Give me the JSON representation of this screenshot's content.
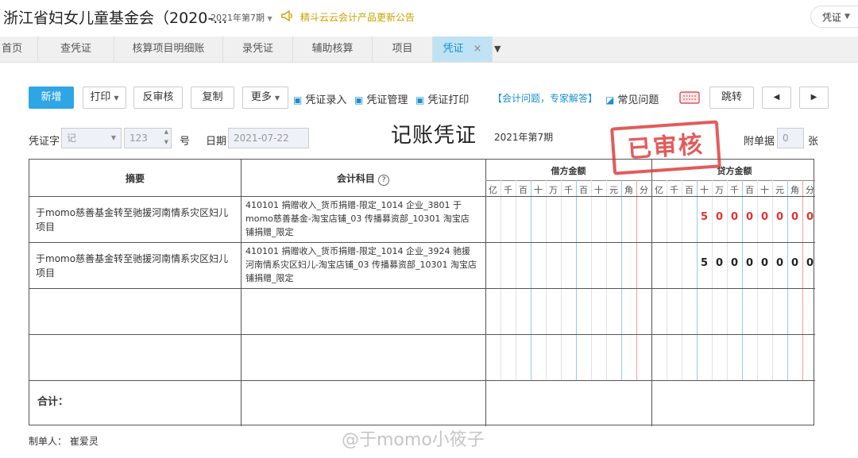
{
  "header": {
    "org_title": "浙江省妇女儿童基金会（2020-...",
    "period_selector": "2021年第7期",
    "notice": "精斗云云会计产品更新公告",
    "voucher_menu": "凭证"
  },
  "tabs": [
    {
      "label": "首页"
    },
    {
      "label": "查凭证"
    },
    {
      "label": "核算项目明细账"
    },
    {
      "label": "录凭证"
    },
    {
      "label": "辅助核算"
    },
    {
      "label": "项目"
    },
    {
      "label": "凭证",
      "active": true
    }
  ],
  "toolbar": {
    "add": "新增",
    "print": "打印",
    "unaudit": "反审核",
    "copy": "复制",
    "more": "更多",
    "entry_link": "凭证录入",
    "manage_link": "凭证管理",
    "print_link": "凭证打印",
    "help_link": "【会计问题，专家解答】",
    "faq_link": "常见问题",
    "jump": "跳转"
  },
  "voucher_header": {
    "word_label": "凭证字",
    "word_value": "记",
    "number_value": "123",
    "number_unit": "号",
    "date_label": "日期",
    "date_value": "2021-07-22",
    "title": "记账凭证",
    "period": "2021年第7期",
    "attach_label": "附单据",
    "attach_value": "0",
    "attach_unit": "张",
    "stamp": "已审核"
  },
  "table": {
    "col_summary": "摘要",
    "col_account": "会计科目",
    "col_debit": "借方金额",
    "col_credit": "贷方金额",
    "digit_units": [
      "亿",
      "千",
      "百",
      "十",
      "万",
      "千",
      "百",
      "十",
      "元",
      "角",
      "分"
    ],
    "rows": [
      {
        "summary": "于momo慈善基金转至驰援河南情系灾区妇儿项目",
        "account": "410101 捐赠收入_货币捐赠-限定_1014 企业_3801 于momo慈善基金-淘宝店铺_03 传播募资部_10301 淘宝店铺捐赠_限定",
        "credit_digits": [
          "5",
          "0",
          "0",
          "0",
          "0",
          "0",
          "0",
          "0"
        ],
        "credit_color": "#d33"
      },
      {
        "summary": "于momo慈善基金转至驰援河南情系灾区妇儿项目",
        "account": "410101 捐赠收入_货币捐赠-限定_1014 企业_3924 驰援河南情系灾区妇儿-淘宝店铺_03 传播募资部_10301 淘宝店铺捐赠_限定",
        "credit_digits": [
          "5",
          "0",
          "0",
          "0",
          "0",
          "0",
          "0",
          "0"
        ],
        "credit_color": "#222"
      }
    ],
    "total_label": "合计："
  },
  "footer": {
    "preparer": "制单人： 崔爱灵",
    "watermark": "@于momo小筱子"
  },
  "colors": {
    "accent": "#2ea6e6",
    "stamp": "#d33",
    "link": "#1a8fcf",
    "notice": "#c8a100"
  }
}
